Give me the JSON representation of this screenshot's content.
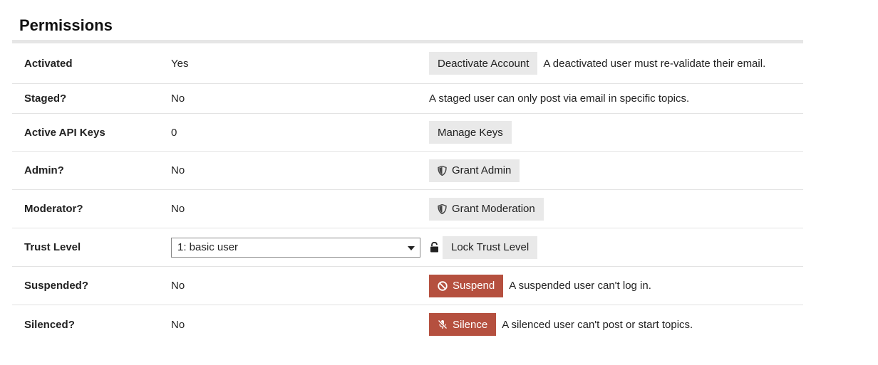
{
  "section": {
    "title": "Permissions"
  },
  "rows": {
    "activated": {
      "label": "Activated",
      "value": "Yes",
      "button": "Deactivate Account",
      "help": "A deactivated user must re-validate their email."
    },
    "staged": {
      "label": "Staged?",
      "value": "No",
      "help": "A staged user can only post via email in specific topics."
    },
    "api_keys": {
      "label": "Active API Keys",
      "value": "0",
      "button": "Manage Keys"
    },
    "admin": {
      "label": "Admin?",
      "value": "No",
      "button": "Grant Admin",
      "button_icon": "shield-icon"
    },
    "moderator": {
      "label": "Moderator?",
      "value": "No",
      "button": "Grant Moderation",
      "button_icon": "shield-icon"
    },
    "trust_level": {
      "label": "Trust Level",
      "selected": "1: basic user",
      "lock_icon": "unlock-icon",
      "button": "Lock Trust Level"
    },
    "suspended": {
      "label": "Suspended?",
      "value": "No",
      "button": "Suspend",
      "button_icon": "ban-icon",
      "help": "A suspended user can't log in."
    },
    "silenced": {
      "label": "Silenced?",
      "value": "No",
      "button": "Silence",
      "button_icon": "microphone-slash-icon",
      "help": "A silenced user can't post or start topics."
    }
  },
  "colors": {
    "danger": "#b5503f",
    "button_bg": "#e9e9e9",
    "divider": "#e3e3e3",
    "title_rule": "#e6e6e6"
  }
}
